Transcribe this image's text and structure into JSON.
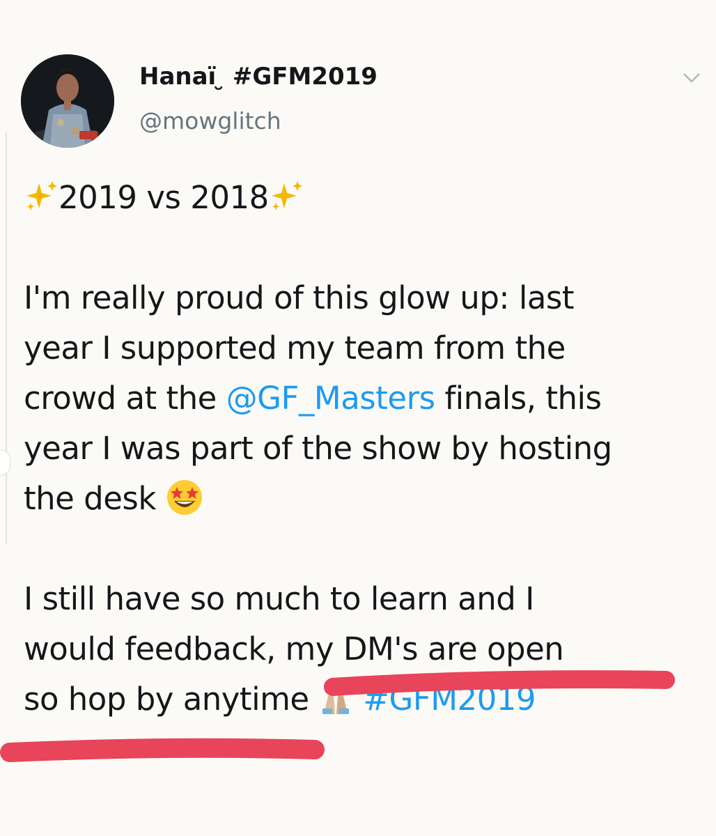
{
  "tweet": {
    "display_name": "Hanaï ̮ #GFM2019",
    "handle": "@mowglitch",
    "title_line": "2019 vs 2018",
    "para1_line1": "I'm really proud of this glow up: last",
    "para1_line2": "year I supported my team from the",
    "para1_line3_pre": "crowd at the ",
    "para1_mention": "@GF_Masters",
    "para1_line3_post": " finals, this",
    "para1_line4": "year I was part of the show by hosting",
    "para1_line5": "the desk",
    "para2_line1": "I still have so much to learn and I",
    "para2_line2": "would feedback, my DM's are open",
    "para2_line3": "so hop by anytime",
    "hashtag": "#GFM2019"
  },
  "icons": {
    "avatar": "profile-photo",
    "chevron": "chevron-down-icon",
    "sparkles": "sparkles-emoji",
    "star_eyes": "star-struck-emoji",
    "pray": "folded-hands-emoji"
  },
  "colors": {
    "link": "#1d9bf0",
    "text": "#14171a",
    "muted": "#66757f",
    "annotation": "#e8445a",
    "sparkle": "#f5b700"
  }
}
